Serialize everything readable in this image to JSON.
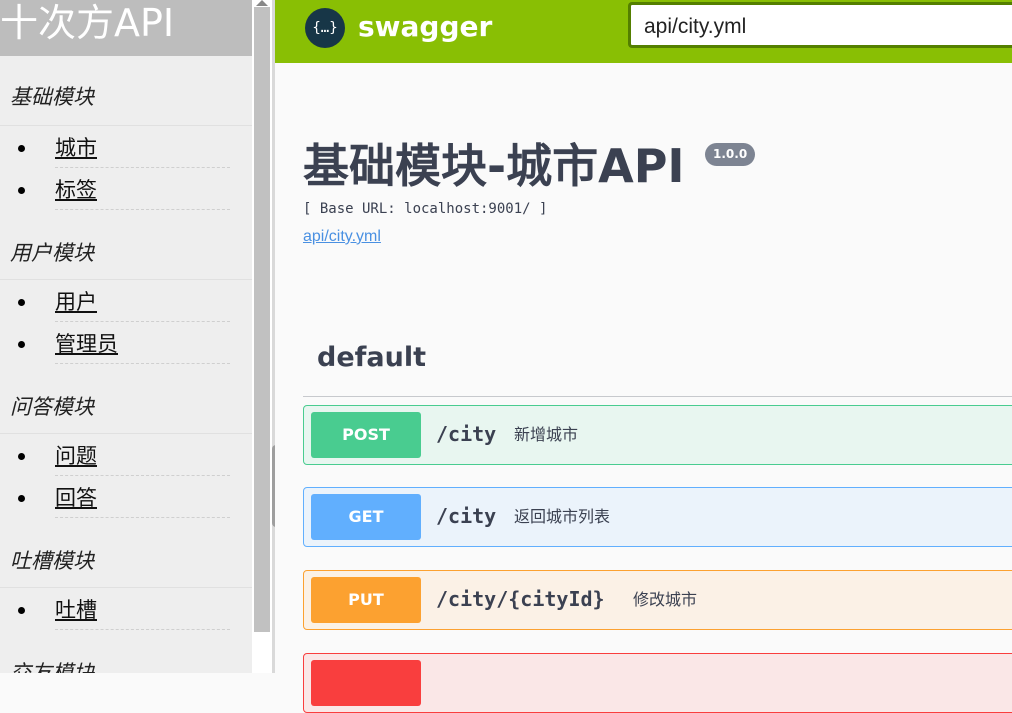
{
  "sidebar": {
    "brand": "十次方API",
    "groups": [
      {
        "title": "基础模块",
        "items": [
          "城市",
          "标签"
        ]
      },
      {
        "title": "用户模块",
        "items": [
          "用户",
          "管理员"
        ]
      },
      {
        "title": "问答模块",
        "items": [
          "问题",
          "回答"
        ]
      },
      {
        "title": "吐槽模块",
        "items": [
          "吐槽"
        ]
      },
      {
        "title": "交友模块",
        "items": []
      }
    ]
  },
  "topbar": {
    "logo_glyph": "{…}",
    "logo_text": "swagger",
    "url_value": "api/city.yml"
  },
  "info": {
    "title": "基础模块-城市API",
    "version": "1.0.0",
    "base_url": "[ Base URL: localhost:9001/ ]",
    "spec_link": "api/city.yml"
  },
  "section": {
    "name": "default"
  },
  "operations": [
    {
      "method": "POST",
      "path": "/city",
      "summary": "新增城市"
    },
    {
      "method": "GET",
      "path": "/city",
      "summary": "返回城市列表"
    },
    {
      "method": "PUT",
      "path": "/city/{cityId}",
      "summary": "修改城市"
    },
    {
      "method": "",
      "path": "",
      "summary": ""
    }
  ],
  "colors": {
    "topbar": "#89bf04",
    "post": "#49cc90",
    "get": "#61affe",
    "put": "#fca130",
    "delete": "#f93e3e"
  }
}
